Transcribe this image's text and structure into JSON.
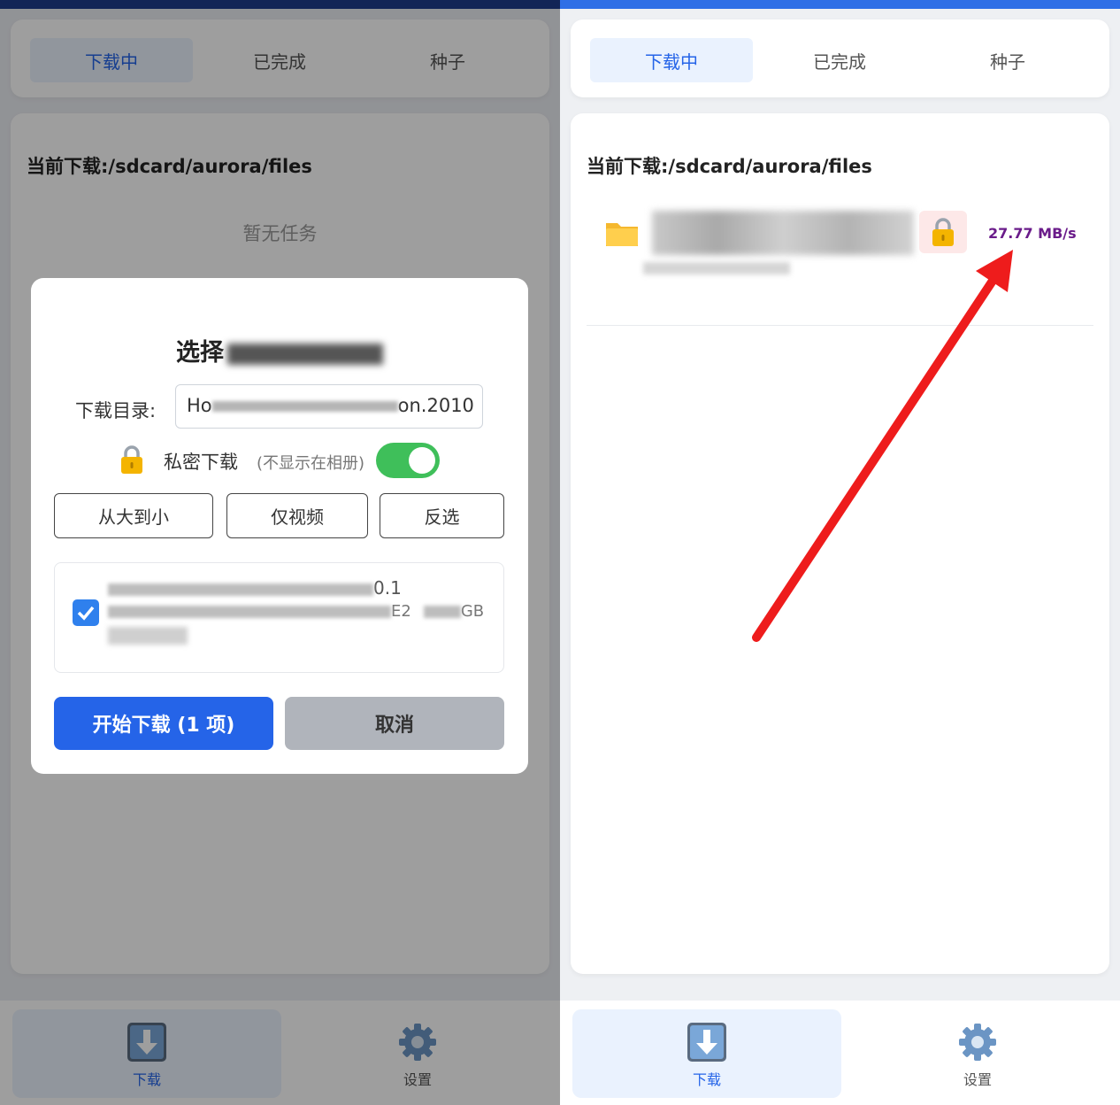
{
  "tabs": [
    {
      "label": "下载中",
      "active": true
    },
    {
      "label": "已完成",
      "active": false
    },
    {
      "label": "种子",
      "active": false
    }
  ],
  "current_download": {
    "label": "当前下载:",
    "path": "/sdcard/aurora/files"
  },
  "empty_state": "暂无任务",
  "dialog": {
    "title_visible": "选择",
    "dir_label": "下载目录:",
    "dir_value_start": "Ho",
    "dir_value_end": "on.2010",
    "lock_icon": "lock-icon",
    "private_label": "私密下载",
    "private_hint": "(不显示在相册)",
    "private_enabled": true,
    "sort_buttons": [
      "从大到小",
      "仅视频",
      "反选"
    ],
    "file": {
      "checked": true,
      "line1_end": "0.1",
      "line2_end": "E2",
      "size_unit": "GB"
    },
    "start_button": "开始下载 (1 项)",
    "cancel_button": "取消"
  },
  "task": {
    "folder_icon": "folder-icon",
    "lock_icon": "lock-icon",
    "speed": "27.77 MB/s"
  },
  "bottom_nav": [
    {
      "label": "下载",
      "icon": "download-icon",
      "active": true
    },
    {
      "label": "设置",
      "icon": "gear-icon",
      "active": false
    }
  ],
  "colors": {
    "accent": "#2564e8",
    "switch_on": "#3fbf5a",
    "speed": "#6a1b8a",
    "arrow": "#ee1c1c"
  }
}
